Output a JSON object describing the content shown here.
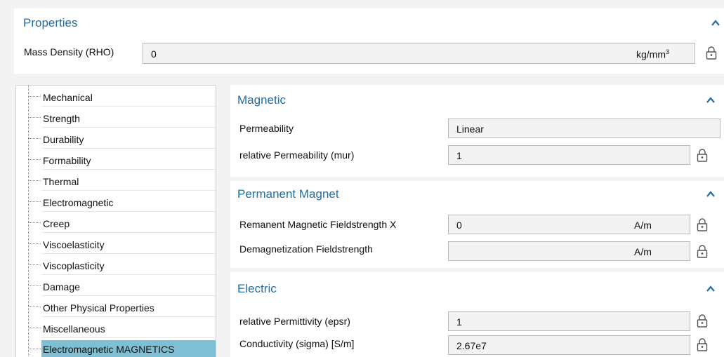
{
  "properties": {
    "title": "Properties",
    "mass_density": {
      "label": "Mass Density (RHO)",
      "value": "0",
      "unit": "kg/mm",
      "unit_exp": "3"
    }
  },
  "tree": {
    "items": [
      {
        "label": "Mechanical",
        "selected": false
      },
      {
        "label": "Strength",
        "selected": false
      },
      {
        "label": "Durability",
        "selected": false
      },
      {
        "label": "Formability",
        "selected": false
      },
      {
        "label": "Thermal",
        "selected": false
      },
      {
        "label": "Electromagnetic",
        "selected": false
      },
      {
        "label": "Creep",
        "selected": false
      },
      {
        "label": "Viscoelasticity",
        "selected": false
      },
      {
        "label": "Viscoplasticity",
        "selected": false
      },
      {
        "label": "Damage",
        "selected": false
      },
      {
        "label": "Other Physical Properties",
        "selected": false
      },
      {
        "label": "Miscellaneous",
        "selected": false
      },
      {
        "label": "Electromagnetic MAGNETICS",
        "selected": true
      }
    ]
  },
  "magnetic": {
    "title": "Magnetic",
    "permeability": {
      "label": "Permeability",
      "value": "Linear"
    },
    "relative_permeability": {
      "label": "relative Permeability (mur)",
      "value": "1"
    }
  },
  "permanent_magnet": {
    "title": "Permanent Magnet",
    "remanent": {
      "label": "Remanent Magnetic Fieldstrength X",
      "value": "0",
      "unit": "A/m"
    },
    "demagnetization": {
      "label": "Demagnetization Fieldstrength",
      "value": "",
      "unit": "A/m"
    }
  },
  "electric": {
    "title": "Electric",
    "permittivity": {
      "label": "relative Permittivity (epsr)",
      "value": "1"
    },
    "conductivity": {
      "label": "Conductivity (sigma) [S/m]",
      "value": "2.67e7"
    }
  },
  "colors": {
    "accent": "#1f6ea6",
    "selection": "#7fbfd4",
    "field_bg": "#f3f3f3",
    "field_border": "#b9b9b9"
  }
}
